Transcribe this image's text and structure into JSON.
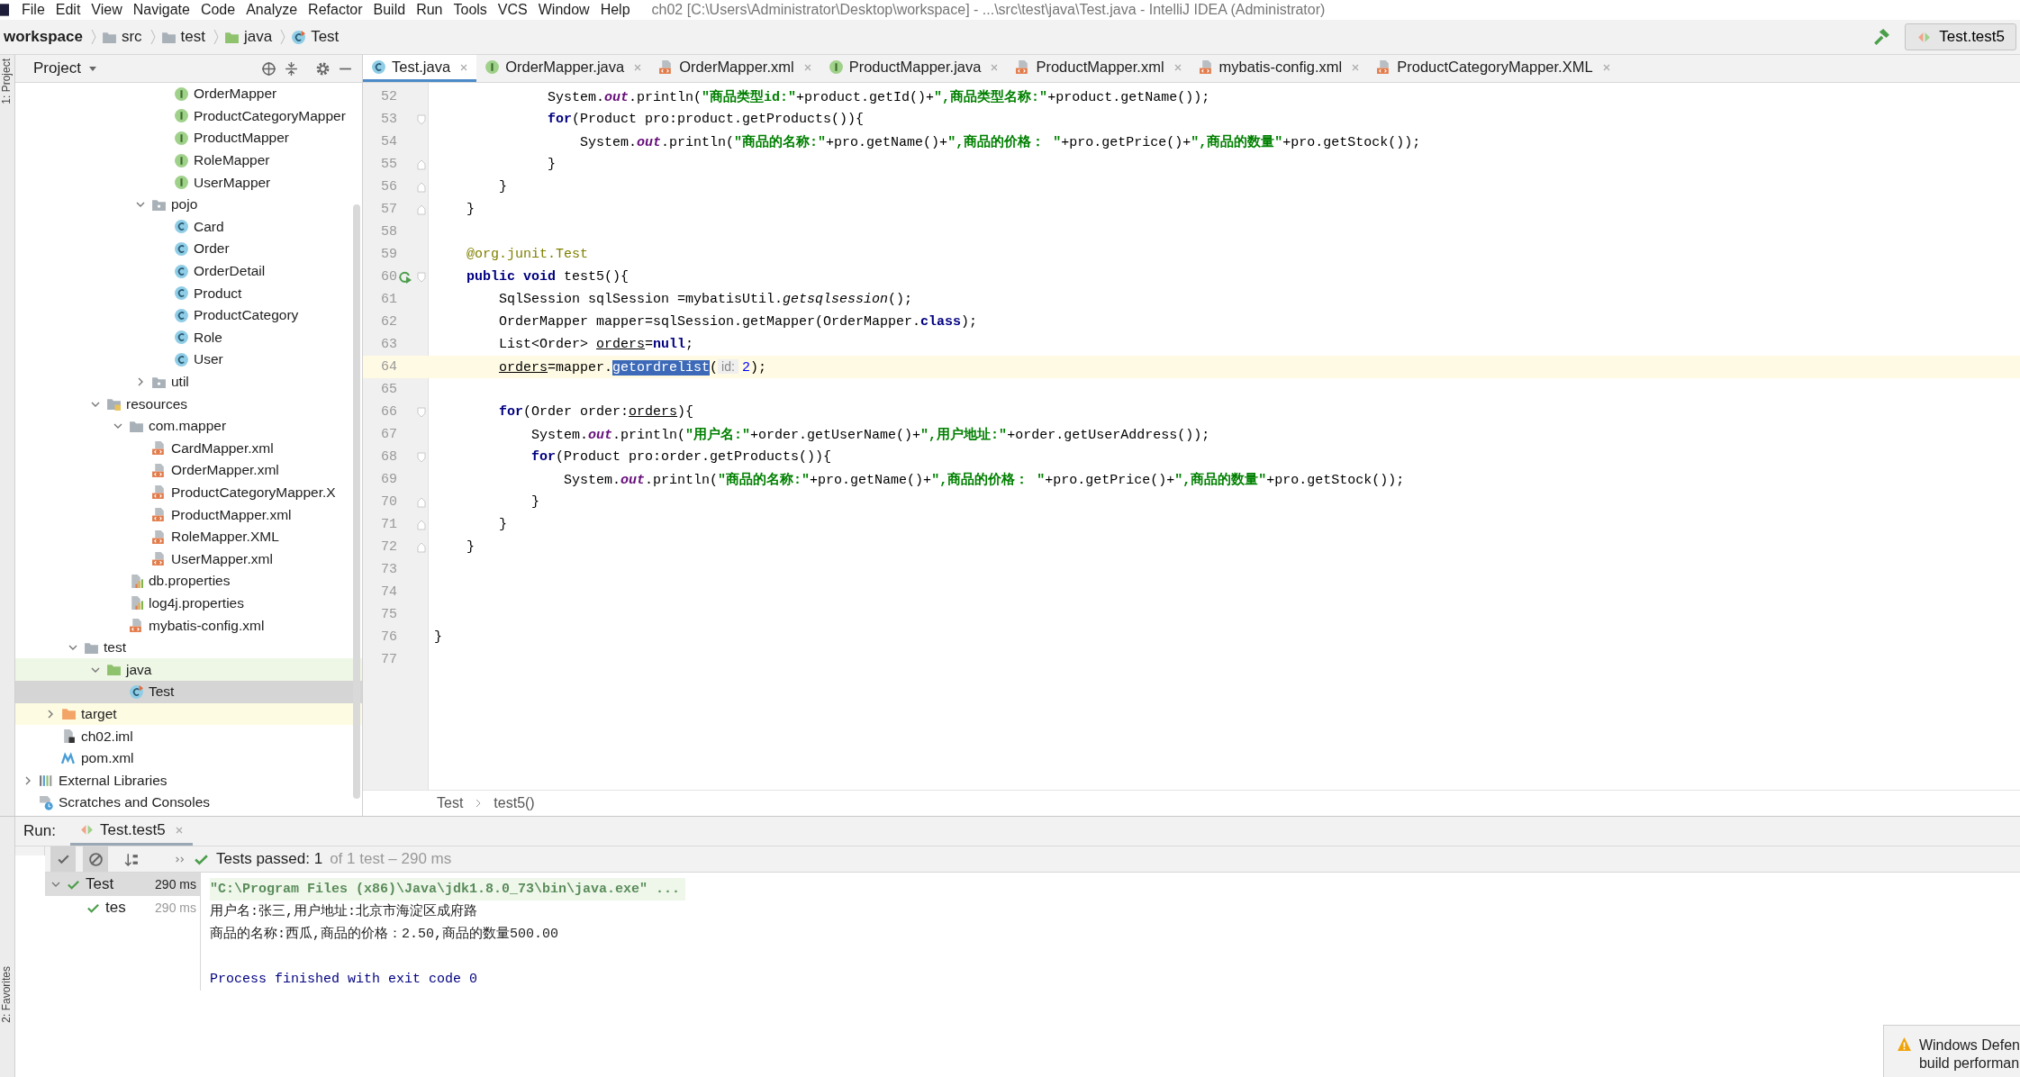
{
  "menu": [
    "File",
    "Edit",
    "View",
    "Navigate",
    "Code",
    "Analyze",
    "Refactor",
    "Build",
    "Run",
    "Tools",
    "VCS",
    "Window",
    "Help"
  ],
  "window": {
    "title": "ch02 [C:\\Users\\Administrator\\Desktop\\workspace] - ...\\src\\test\\java\\Test.java - IntelliJ IDEA (Administrator)"
  },
  "breadcrumbs": [
    {
      "label": "workspace",
      "kind": "project"
    },
    {
      "label": "src",
      "kind": "folder"
    },
    {
      "label": "test",
      "kind": "folder"
    },
    {
      "label": "java",
      "kind": "test-folder"
    },
    {
      "label": "Test",
      "kind": "test-class"
    }
  ],
  "run_configuration": "Test.test5",
  "side_strip": {
    "top": "1: Project",
    "bottom": "2: Favorites"
  },
  "project_panel": {
    "title": "Project"
  },
  "project_tree": [
    {
      "children": [
        {
          "children": [
            {
              "children": [
                {
                  "children": [
                    {
                      "children": [
                        {
                          "children": [
                            {
                              "label": "OrderMapper",
                              "kind": "interface",
                              "selected": false
                            },
                            {
                              "label": "ProductCategoryMapper",
                              "kind": "interface",
                              "selected": false
                            },
                            {
                              "label": "ProductMapper",
                              "kind": "interface",
                              "selected": false
                            },
                            {
                              "label": "RoleMapper",
                              "kind": "interface",
                              "selected": false
                            },
                            {
                              "label": "UserMapper",
                              "kind": "interface",
                              "selected": false
                            }
                          ]
                        },
                        {
                          "label": "pojo",
                          "kind": "package",
                          "expanded": true,
                          "selected": false,
                          "children": [
                            {
                              "label": "Card",
                              "kind": "class",
                              "selected": false
                            },
                            {
                              "label": "Order",
                              "kind": "class",
                              "selected": false
                            },
                            {
                              "label": "OrderDetail",
                              "kind": "class",
                              "selected": false
                            },
                            {
                              "label": "Product",
                              "kind": "class",
                              "selected": false
                            },
                            {
                              "label": "ProductCategory",
                              "kind": "class",
                              "selected": false
                            },
                            {
                              "label": "Role",
                              "kind": "class",
                              "selected": false
                            },
                            {
                              "label": "User",
                              "kind": "class",
                              "selected": false
                            }
                          ]
                        },
                        {
                          "label": "util",
                          "kind": "package",
                          "expanded": false,
                          "selected": false
                        }
                      ]
                    }
                  ]
                },
                {
                  "label": "resources",
                  "kind": "resources",
                  "expanded": true,
                  "selected": false,
                  "children": [
                    {
                      "label": "com.mapper",
                      "kind": "folder",
                      "expanded": true,
                      "selected": false,
                      "children": [
                        {
                          "label": "CardMapper.xml",
                          "kind": "xml",
                          "selected": false
                        },
                        {
                          "label": "OrderMapper.xml",
                          "kind": "xml",
                          "selected": false
                        },
                        {
                          "label": "ProductCategoryMapper.X",
                          "kind": "xml",
                          "selected": false
                        },
                        {
                          "label": "ProductMapper.xml",
                          "kind": "xml",
                          "selected": false
                        },
                        {
                          "label": "RoleMapper.XML",
                          "kind": "xml",
                          "selected": false
                        },
                        {
                          "label": "UserMapper.xml",
                          "kind": "xml",
                          "selected": false
                        }
                      ]
                    },
                    {
                      "label": "db.properties",
                      "kind": "properties",
                      "selected": false
                    },
                    {
                      "label": "log4j.properties",
                      "kind": "properties",
                      "selected": false
                    },
                    {
                      "label": "mybatis-config.xml",
                      "kind": "xml",
                      "selected": false
                    }
                  ]
                }
              ]
            },
            {
              "label": "test",
              "kind": "folder",
              "expanded": true,
              "selected": false,
              "children": [
                {
                  "label": "java",
                  "kind": "test-folder",
                  "expanded": true,
                  "selected": false,
                  "children": [
                    {
                      "label": "Test",
                      "kind": "test-class",
                      "selected": true
                    }
                  ]
                }
              ]
            }
          ]
        },
        {
          "label": "target",
          "kind": "excluded-folder",
          "expanded": false,
          "selected": false
        },
        {
          "label": "ch02.iml",
          "kind": "iml",
          "selected": false
        },
        {
          "label": "pom.xml",
          "kind": "maven",
          "selected": false
        }
      ]
    },
    {
      "label": "External Libraries",
      "kind": "libraries",
      "expanded": false,
      "selected": false
    },
    {
      "label": "Scratches and Consoles",
      "kind": "scratches",
      "selected": false
    }
  ],
  "editor_tabs": [
    {
      "label": "Test.java",
      "kind": "class",
      "selected": true
    },
    {
      "label": "OrderMapper.java",
      "kind": "interface",
      "selected": false
    },
    {
      "label": "OrderMapper.xml",
      "kind": "xml",
      "selected": false
    },
    {
      "label": "ProductMapper.java",
      "kind": "interface",
      "selected": false
    },
    {
      "label": "ProductMapper.xml",
      "kind": "xml",
      "selected": false
    },
    {
      "label": "mybatis-config.xml",
      "kind": "xml",
      "selected": false
    },
    {
      "label": "ProductCategoryMapper.XML",
      "kind": "xml",
      "selected": false
    }
  ],
  "code_lines": [
    {
      "number": "52",
      "fold_start": false,
      "fold_end": false,
      "current": false,
      "tokens": [
        {
          "kind": "plain",
          "text": "              System."
        },
        {
          "kind": "field",
          "text": "out"
        },
        {
          "kind": "plain",
          "text": ".println("
        },
        {
          "kind": "string",
          "text": "\"商品类型id:\""
        },
        {
          "kind": "plain",
          "text": "+product.getId()+"
        },
        {
          "kind": "string",
          "text": "\",商品类型名称:\""
        },
        {
          "kind": "plain",
          "text": "+product.getName());"
        }
      ]
    },
    {
      "number": "53",
      "fold_start": true,
      "fold_end": false,
      "current": false,
      "tokens": [
        {
          "kind": "keyword",
          "text": "              for"
        },
        {
          "kind": "plain",
          "text": "(Product pro:product.getProducts()){"
        }
      ]
    },
    {
      "number": "54",
      "fold_start": false,
      "fold_end": false,
      "current": false,
      "tokens": [
        {
          "kind": "plain",
          "text": "                  System."
        },
        {
          "kind": "field",
          "text": "out"
        },
        {
          "kind": "plain",
          "text": ".println("
        },
        {
          "kind": "string",
          "text": "\"商品的名称:\""
        },
        {
          "kind": "plain",
          "text": "+pro.getName()+"
        },
        {
          "kind": "string",
          "text": "\",商品的价格： \""
        },
        {
          "kind": "plain",
          "text": "+pro.getPrice()+"
        },
        {
          "kind": "string",
          "text": "\",商品的数量\""
        },
        {
          "kind": "plain",
          "text": "+pro.getStock());"
        }
      ]
    },
    {
      "number": "55",
      "fold_start": false,
      "fold_end": true,
      "current": false,
      "tokens": [
        {
          "kind": "plain",
          "text": "              }"
        }
      ]
    },
    {
      "number": "56",
      "fold_start": false,
      "fold_end": true,
      "current": false,
      "tokens": [
        {
          "kind": "plain",
          "text": "        }"
        }
      ]
    },
    {
      "number": "57",
      "fold_start": false,
      "fold_end": true,
      "current": false,
      "tokens": [
        {
          "kind": "plain",
          "text": "    }"
        }
      ]
    },
    {
      "number": "58",
      "fold_start": false,
      "fold_end": false,
      "current": false
    },
    {
      "number": "59",
      "fold_start": false,
      "fold_end": false,
      "current": false,
      "tokens": [
        {
          "kind": "annotation",
          "text": "    @org.junit.Test"
        }
      ]
    },
    {
      "number": "60",
      "fold_start": true,
      "fold_end": false,
      "current": false,
      "run_icon": true,
      "tokens": [
        {
          "kind": "keyword",
          "text": "    public void "
        },
        {
          "kind": "plain",
          "text": "test5(){"
        }
      ]
    },
    {
      "number": "61",
      "fold_start": false,
      "fold_end": false,
      "current": false,
      "tokens": [
        {
          "kind": "plain",
          "text": "        SqlSession sqlSession =mybatisUtil."
        },
        {
          "kind": "static-method",
          "text": "getsqlsession"
        },
        {
          "kind": "plain",
          "text": "();"
        }
      ]
    },
    {
      "number": "62",
      "fold_start": false,
      "fold_end": false,
      "current": false,
      "tokens": [
        {
          "kind": "plain",
          "text": "        OrderMapper mapper=sqlSession.getMapper(OrderMapper."
        },
        {
          "kind": "keyword",
          "text": "class"
        },
        {
          "kind": "plain",
          "text": ");"
        }
      ]
    },
    {
      "number": "63",
      "fold_start": false,
      "fold_end": false,
      "current": false,
      "tokens": [
        {
          "kind": "plain",
          "text": "        List<Order> "
        },
        {
          "kind": "reassigned",
          "text": "orders"
        },
        {
          "kind": "plain",
          "text": "="
        },
        {
          "kind": "keyword",
          "text": "null"
        },
        {
          "kind": "plain",
          "text": ";"
        }
      ]
    },
    {
      "number": "64",
      "fold_start": false,
      "fold_end": false,
      "current": true,
      "tokens": [
        {
          "kind": "reassigned",
          "text": "        orders"
        },
        {
          "kind": "plain",
          "text": "=mapper."
        },
        {
          "kind": "selection",
          "text": "getordrelist"
        },
        {
          "kind": "plain",
          "text": "("
        },
        {
          "kind": "hint",
          "text": "id:"
        },
        {
          "kind": "number",
          "text": "2"
        },
        {
          "kind": "plain",
          "text": ");"
        }
      ]
    },
    {
      "number": "65",
      "fold_start": false,
      "fold_end": false,
      "current": false
    },
    {
      "number": "66",
      "fold_start": true,
      "fold_end": false,
      "current": false,
      "tokens": [
        {
          "kind": "keyword",
          "text": "        for"
        },
        {
          "kind": "plain",
          "text": "(Order order:"
        },
        {
          "kind": "reassigned",
          "text": "orders"
        },
        {
          "kind": "plain",
          "text": "){"
        }
      ]
    },
    {
      "number": "67",
      "fold_start": false,
      "fold_end": false,
      "current": false,
      "tokens": [
        {
          "kind": "plain",
          "text": "            System."
        },
        {
          "kind": "field",
          "text": "out"
        },
        {
          "kind": "plain",
          "text": ".println("
        },
        {
          "kind": "string",
          "text": "\"用户名:\""
        },
        {
          "kind": "plain",
          "text": "+order.getUserName()+"
        },
        {
          "kind": "string",
          "text": "\",用户地址:\""
        },
        {
          "kind": "plain",
          "text": "+order.getUserAddress());"
        }
      ]
    },
    {
      "number": "68",
      "fold_start": true,
      "fold_end": false,
      "current": false,
      "tokens": [
        {
          "kind": "keyword",
          "text": "            for"
        },
        {
          "kind": "plain",
          "text": "(Product pro:order.getProducts()){"
        }
      ]
    },
    {
      "number": "69",
      "fold_start": false,
      "fold_end": false,
      "current": false,
      "tokens": [
        {
          "kind": "plain",
          "text": "                System."
        },
        {
          "kind": "field",
          "text": "out"
        },
        {
          "kind": "plain",
          "text": ".println("
        },
        {
          "kind": "string",
          "text": "\"商品的名称:\""
        },
        {
          "kind": "plain",
          "text": "+pro.getName()+"
        },
        {
          "kind": "string",
          "text": "\",商品的价格： \""
        },
        {
          "kind": "plain",
          "text": "+pro.getPrice()+"
        },
        {
          "kind": "string",
          "text": "\",商品的数量\""
        },
        {
          "kind": "plain",
          "text": "+pro.getStock());"
        }
      ]
    },
    {
      "number": "70",
      "fold_start": false,
      "fold_end": true,
      "current": false,
      "tokens": [
        {
          "kind": "plain",
          "text": "            }"
        }
      ]
    },
    {
      "number": "71",
      "fold_start": false,
      "fold_end": true,
      "current": false,
      "tokens": [
        {
          "kind": "plain",
          "text": "        }"
        }
      ]
    },
    {
      "number": "72",
      "fold_start": false,
      "fold_end": true,
      "current": false,
      "tokens": [
        {
          "kind": "plain",
          "text": "    }"
        }
      ]
    },
    {
      "number": "73",
      "fold_start": false,
      "fold_end": false,
      "current": false
    },
    {
      "number": "74",
      "fold_start": false,
      "fold_end": false,
      "current": false
    },
    {
      "number": "75",
      "fold_start": false,
      "fold_end": false,
      "current": false
    },
    {
      "number": "76",
      "fold_start": false,
      "fold_end": false,
      "current": false,
      "tokens": [
        {
          "kind": "plain",
          "text": "}"
        }
      ]
    },
    {
      "number": "77",
      "fold_start": false,
      "fold_end": false,
      "current": false
    }
  ],
  "editor_breadcrumbs": [
    "Test",
    "test5()"
  ],
  "run_panel": {
    "label": "Run:",
    "tab": "Test.test5",
    "status": {
      "main": "Tests passed: 1",
      "detail": "of 1 test – 290 ms"
    },
    "test_tree": [
      {
        "label": "Test",
        "time": "290 ms",
        "selected": true,
        "expanded": true,
        "children": [
          {
            "label": "tes",
            "time": "290 ms",
            "selected": false
          }
        ]
      }
    ],
    "console": [
      {
        "kind": "command",
        "text": "\"C:\\Program Files (x86)\\Java\\jdk1.8.0_73\\bin\\java.exe\" ..."
      },
      {
        "kind": "output",
        "text": "用户名:张三,用户地址:北京市海淀区成府路"
      },
      {
        "kind": "output",
        "text": "商品的名称:西瓜,商品的价格：2.50,商品的数量500.00"
      },
      {
        "kind": "exit",
        "text": "Process finished with exit code 0"
      }
    ]
  },
  "notification": {
    "lines": [
      "Windows Defen",
      "build performan"
    ]
  }
}
